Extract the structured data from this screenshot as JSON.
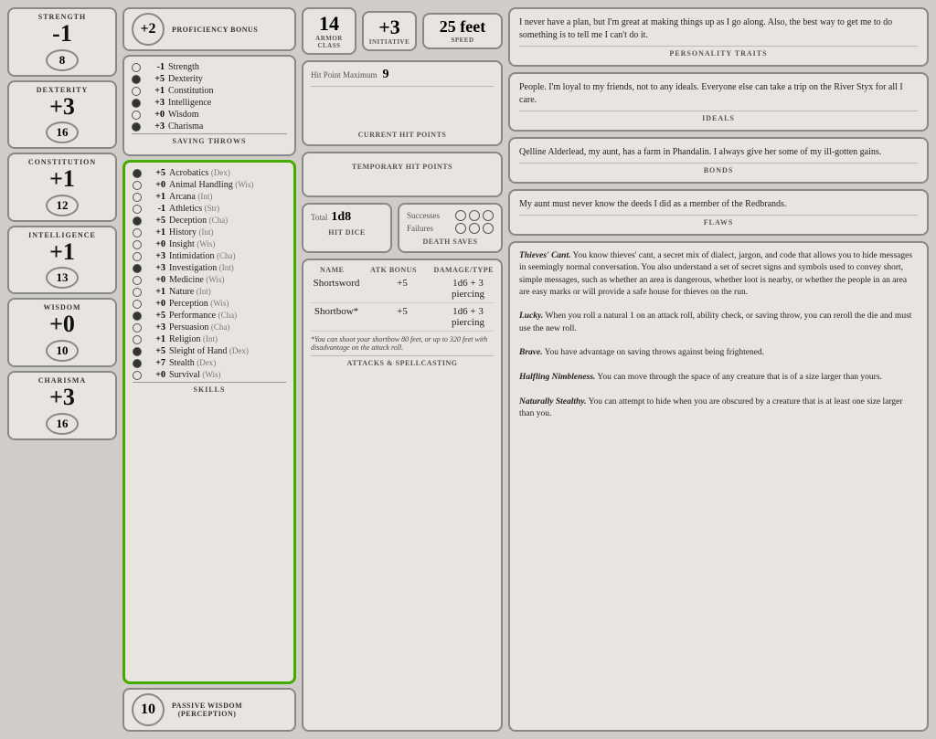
{
  "abilities": [
    {
      "id": "strength",
      "label": "Strength",
      "mod": "-1",
      "score": "8"
    },
    {
      "id": "dexterity",
      "label": "Dexterity",
      "mod": "+3",
      "score": "16"
    },
    {
      "id": "constitution",
      "label": "Constitution",
      "mod": "+1",
      "score": "12"
    },
    {
      "id": "intelligence",
      "label": "Intelligence",
      "mod": "+1",
      "score": "13"
    },
    {
      "id": "wisdom",
      "label": "Wisdom",
      "mod": "+0",
      "score": "10"
    },
    {
      "id": "charisma",
      "label": "Charisma",
      "mod": "+3",
      "score": "16"
    }
  ],
  "proficiency_bonus": "+2",
  "proficiency_bonus_label": "Proficiency Bonus",
  "saving_throws_label": "Saving Throws",
  "saving_throws": [
    {
      "filled": false,
      "value": "-1",
      "name": "Strength"
    },
    {
      "filled": true,
      "value": "+5",
      "name": "Dexterity"
    },
    {
      "filled": false,
      "value": "+1",
      "name": "Constitution"
    },
    {
      "filled": true,
      "value": "+3",
      "name": "Intelligence"
    },
    {
      "filled": false,
      "value": "+0",
      "name": "Wisdom"
    },
    {
      "filled": true,
      "value": "+3",
      "name": "Charisma"
    }
  ],
  "skills_label": "Skills",
  "skills": [
    {
      "filled": true,
      "value": "+5",
      "name": "Acrobatics",
      "attr": "Dex"
    },
    {
      "filled": false,
      "value": "+0",
      "name": "Animal Handling",
      "attr": "Wis"
    },
    {
      "filled": false,
      "value": "+1",
      "name": "Arcana",
      "attr": "Int"
    },
    {
      "filled": false,
      "value": "-1",
      "name": "Athletics",
      "attr": "Str"
    },
    {
      "filled": true,
      "value": "+5",
      "name": "Deception",
      "attr": "Cha"
    },
    {
      "filled": false,
      "value": "+1",
      "name": "History",
      "attr": "Int"
    },
    {
      "filled": false,
      "value": "+0",
      "name": "Insight",
      "attr": "Wis"
    },
    {
      "filled": false,
      "value": "+3",
      "name": "Intimidation",
      "attr": "Cha"
    },
    {
      "filled": true,
      "value": "+3",
      "name": "Investigation",
      "attr": "Int"
    },
    {
      "filled": false,
      "value": "+0",
      "name": "Medicine",
      "attr": "Wis"
    },
    {
      "filled": false,
      "value": "+1",
      "name": "Nature",
      "attr": "Int"
    },
    {
      "filled": false,
      "value": "+0",
      "name": "Perception",
      "attr": "Wis"
    },
    {
      "filled": true,
      "value": "+5",
      "name": "Performance",
      "attr": "Cha"
    },
    {
      "filled": false,
      "value": "+3",
      "name": "Persuasion",
      "attr": "Cha"
    },
    {
      "filled": false,
      "value": "+1",
      "name": "Religion",
      "attr": "Int"
    },
    {
      "filled": true,
      "value": "+5",
      "name": "Sleight of Hand",
      "attr": "Dex"
    },
    {
      "filled": true,
      "value": "+7",
      "name": "Stealth",
      "attr": "Dex"
    },
    {
      "filled": false,
      "value": "+0",
      "name": "Survival",
      "attr": "Wis"
    }
  ],
  "passive_wisdom_value": "10",
  "passive_wisdom_label": "Passive Wisdom\n(Perception)",
  "combat": {
    "armor_class": "14",
    "armor_class_label": "Armor\nClass",
    "initiative": "+3",
    "initiative_label": "Initiative",
    "speed": "25 feet",
    "speed_label": "Speed",
    "hp_max_label": "Hit Point Maximum",
    "hp_max": "9",
    "current_hp_label": "Current Hit Points",
    "temp_hp_label": "Temporary Hit Points",
    "hit_dice_total_label": "Total",
    "hit_dice_value": "1d8",
    "hit_dice_label": "Hit Dice",
    "successes_label": "Successes",
    "failures_label": "Failures",
    "death_saves_label": "Death Saves"
  },
  "attacks": {
    "col_name": "Name",
    "col_atk": "ATK Bonus",
    "col_dmg": "Damage/Type",
    "rows": [
      {
        "name": "Shortsword",
        "atk": "+5",
        "dmg": "1d6 + 3 piercing"
      },
      {
        "name": "Shortbow*",
        "atk": "+5",
        "dmg": "1d6 + 3 piercing"
      }
    ],
    "note": "*You can shoot your shortbow 80 feet, or up to 320 feet with disadvantage on the attack roll.",
    "label": "Attacks & Spellcasting"
  },
  "character": {
    "personality": "I never have a plan, but I'm great at making things up as I go along. Also, the best way to get me to do something is to tell me I can't do it.",
    "personality_label": "Personality Traits",
    "ideals": "People. I'm loyal to my friends, not to any ideals. Everyone else can take a trip on the River Styx for all I care.",
    "ideals_label": "Ideals",
    "bonds": "Qelline Alderlead, my aunt, has a farm in Phandalin. I always give her some of my ill-gotten gains.",
    "bonds_label": "Bonds",
    "flaws": "My aunt must never know the deeds I did as a member of the Redbrands.",
    "flaws_label": "Flaws"
  },
  "features": {
    "items": [
      {
        "title": "Thieves' Cant.",
        "text": " You know thieves' cant, a secret mix of dialect, jargon, and code that allows you to hide messages in seemingly normal conversation. You also understand a set of secret signs and symbols used to convey short, simple messages, such as whether an area is dangerous, whether loot is nearby, or whether the people in an area are easy marks or will provide a safe house for thieves on the run."
      },
      {
        "title": "Lucky.",
        "text": " When you roll a natural 1 on an attack roll, ability check, or saving throw, you can reroll the die and must use the new roll."
      },
      {
        "title": "Brave.",
        "text": " You have advantage on saving throws against being frightened."
      },
      {
        "title": "Halfling Nimbleness.",
        "text": " You can move through the space of any creature that is of a size larger than yours."
      },
      {
        "title": "Naturally Stealthy.",
        "text": " You can attempt to hide when you are obscured by a creature that is at least one size larger than you."
      }
    ]
  }
}
